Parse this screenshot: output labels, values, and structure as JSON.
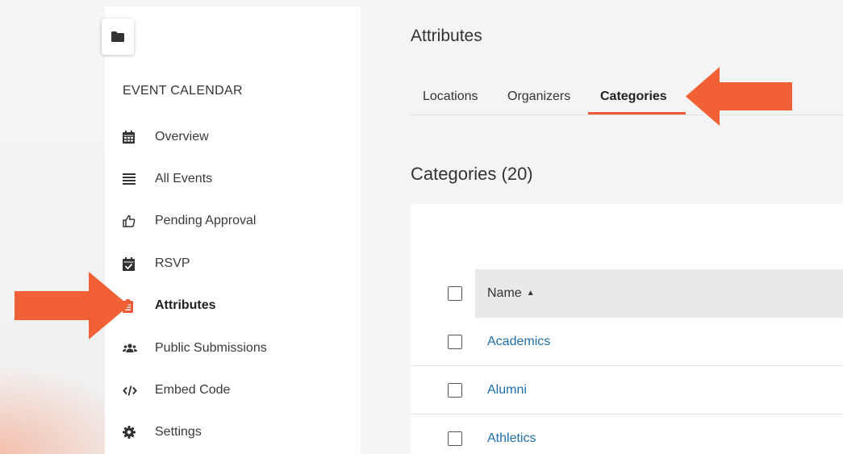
{
  "sidebar": {
    "section_title": "EVENT CALENDAR",
    "items": [
      {
        "label": "Overview",
        "icon": "calendar-grid-icon"
      },
      {
        "label": "All Events",
        "icon": "list-icon"
      },
      {
        "label": "Pending Approval",
        "icon": "thumbs-up-icon"
      },
      {
        "label": "RSVP",
        "icon": "calendar-check-icon"
      },
      {
        "label": "Attributes",
        "icon": "clipboard-list-icon",
        "active": true
      },
      {
        "label": "Public Submissions",
        "icon": "users-icon"
      },
      {
        "label": "Embed Code",
        "icon": "code-icon"
      },
      {
        "label": "Settings",
        "icon": "gear-icon"
      }
    ]
  },
  "main": {
    "title": "Attributes",
    "tabs": [
      {
        "label": "Locations"
      },
      {
        "label": "Organizers"
      },
      {
        "label": "Categories",
        "active": true
      }
    ],
    "section_heading": "Categories (20)",
    "table": {
      "column_name": "Name",
      "rows": [
        "Academics",
        "Alumni",
        "Athletics"
      ]
    }
  },
  "colors": {
    "accent": "#ef5a36",
    "link": "#1f6ea8",
    "arrow": "#f26035"
  }
}
